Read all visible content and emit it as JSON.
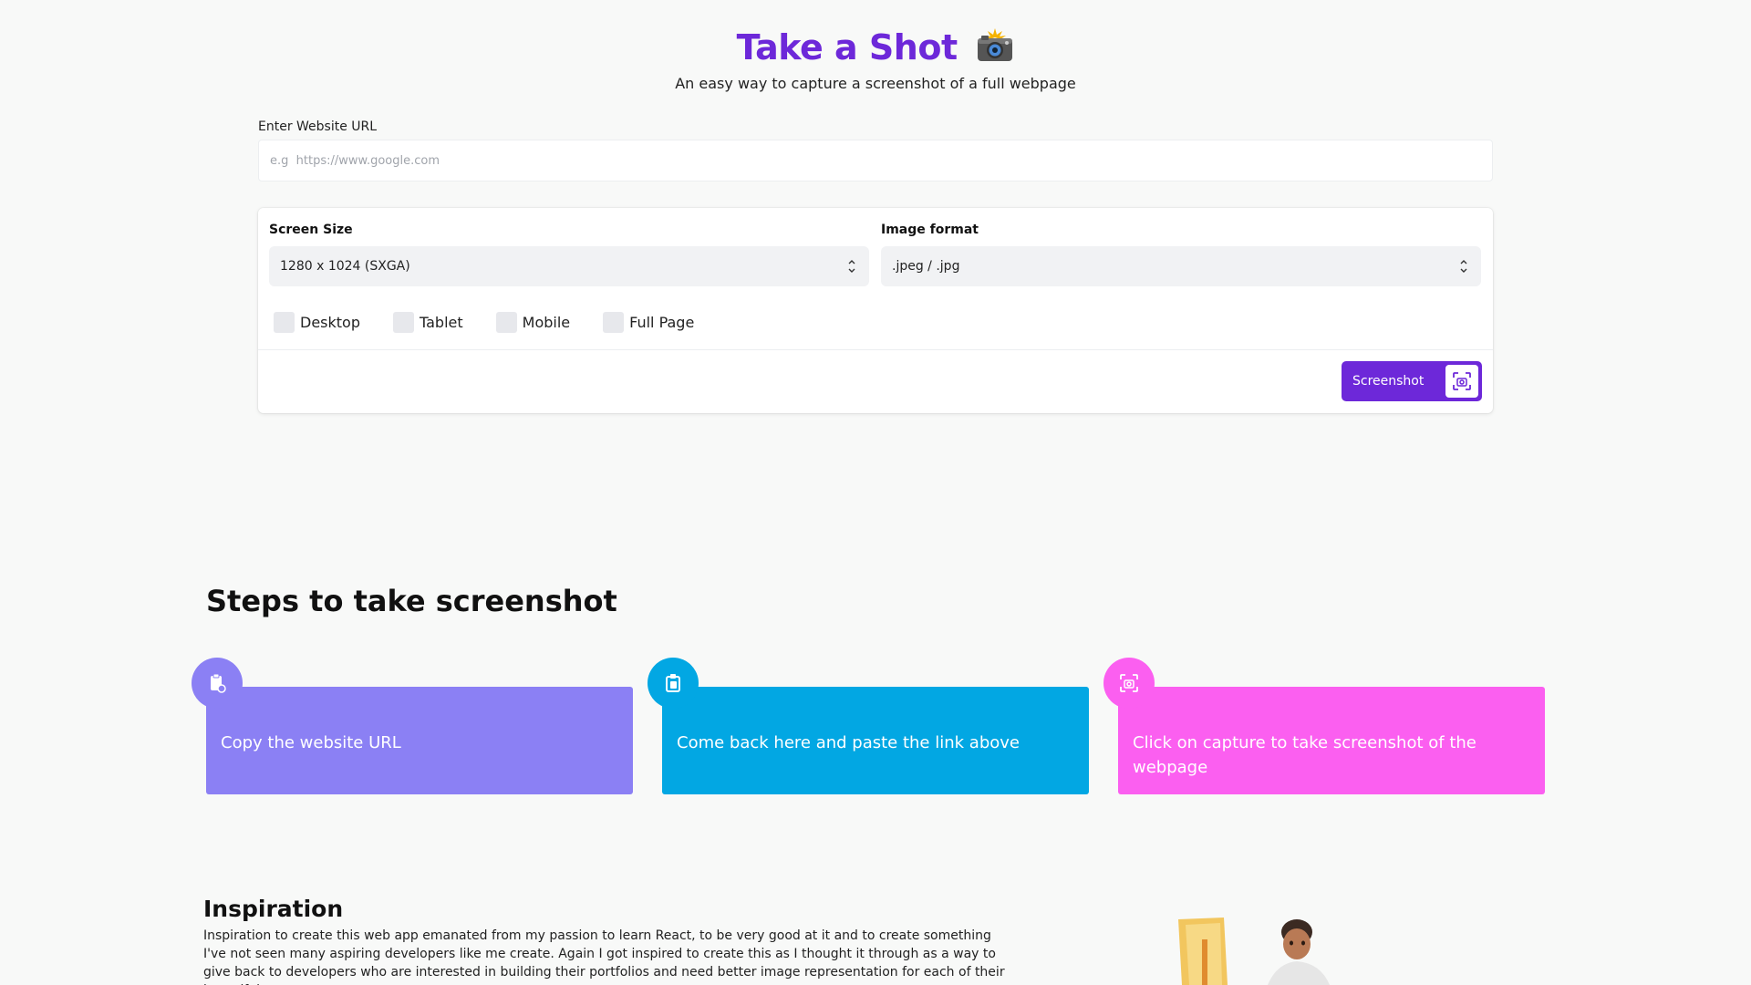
{
  "header": {
    "title": "Take a Shot",
    "camera_emoji": "📸",
    "subtitle": "An easy way to capture a screenshot of a full webpage"
  },
  "url": {
    "label": "Enter Website URL",
    "placeholder": "e.g  https://www.google.com",
    "value": ""
  },
  "options": {
    "screen_size_label": "Screen Size",
    "screen_size_value": "1280 x 1024 (SXGA)",
    "format_label": "Image format",
    "format_value": ".jpeg / .jpg",
    "checkboxes": [
      {
        "label": "Desktop",
        "checked": false
      },
      {
        "label": "Tablet",
        "checked": false
      },
      {
        "label": "Mobile",
        "checked": false
      },
      {
        "label": "Full Page",
        "checked": false
      }
    ],
    "button_label": "Screenshot"
  },
  "steps": {
    "title": "Steps to take screenshot",
    "items": [
      {
        "text": "Copy the website URL",
        "color": "#8b80f4",
        "icon": "clipboard-copy-icon"
      },
      {
        "text": "Come back here and paste the link above",
        "color": "#02a7e3",
        "icon": "paste-icon"
      },
      {
        "text": "Click on capture to take screenshot of the webpage",
        "color": "#fb5ff0",
        "icon": "capture-icon"
      }
    ]
  },
  "inspiration": {
    "title": "Inspiration",
    "text": "Inspiration to create this web app emanated from my passion to learn React, to be very good at it and to create something I've not seen many aspiring developers like me create. Again I got inspired to create this as I thought it through as a way to give back to developers who are interested in building their portfolios and need better image representation for each of their beautiful"
  },
  "colors": {
    "accent": "#6d28d9",
    "background": "#f8f9f8"
  }
}
